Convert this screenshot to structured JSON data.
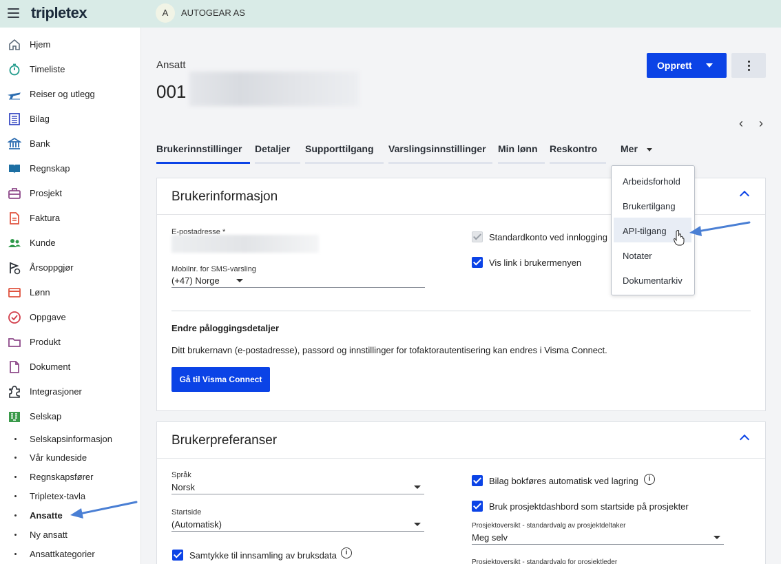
{
  "topbar": {
    "logo": "tripletex",
    "company_initial": "A",
    "company_name": "AUTOGEAR AS"
  },
  "sidebar": {
    "items": [
      {
        "label": "Hjem",
        "icon": "home-icon"
      },
      {
        "label": "Timeliste",
        "icon": "stopwatch-icon"
      },
      {
        "label": "Reiser og utlegg",
        "icon": "plane-icon"
      },
      {
        "label": "Bilag",
        "icon": "receipt-icon"
      },
      {
        "label": "Bank",
        "icon": "bank-icon"
      },
      {
        "label": "Regnskap",
        "icon": "book-icon"
      },
      {
        "label": "Prosjekt",
        "icon": "briefcase-icon"
      },
      {
        "label": "Faktura",
        "icon": "invoice-icon"
      },
      {
        "label": "Kunde",
        "icon": "people-icon"
      },
      {
        "label": "Årsoppgjør",
        "icon": "flag-icon"
      },
      {
        "label": "Lønn",
        "icon": "card-icon"
      },
      {
        "label": "Oppgave",
        "icon": "check-circle-icon"
      },
      {
        "label": "Produkt",
        "icon": "folder-icon"
      },
      {
        "label": "Dokument",
        "icon": "document-icon"
      },
      {
        "label": "Integrasjoner",
        "icon": "puzzle-icon"
      },
      {
        "label": "Selskap",
        "icon": "building-icon"
      }
    ],
    "subitems": [
      {
        "label": "Selskapsinformasjon"
      },
      {
        "label": "Vår kundeside"
      },
      {
        "label": "Regnskapsfører"
      },
      {
        "label": "Tripletex-tavla"
      },
      {
        "label": "Ansatte",
        "active": true
      },
      {
        "label": "Ny ansatt"
      },
      {
        "label": "Ansattkategorier"
      }
    ]
  },
  "page": {
    "breadcrumb": "Ansatt",
    "employee_number": "001",
    "create_button": "Opprett",
    "tabs": [
      "Brukerinnstillinger",
      "Detaljer",
      "Supporttilgang",
      "Varslingsinnstillinger",
      "Min lønn",
      "Reskontro",
      "Mer"
    ],
    "more_menu": [
      "Arbeidsforhold",
      "Brukertilgang",
      "API-tilgang",
      "Notater",
      "Dokumentarkiv"
    ]
  },
  "user_info": {
    "title": "Brukerinformasjon",
    "email_label": "E-postadresse *",
    "mobile_label": "Mobilnr. for SMS-varsling",
    "mobile_value": "(+47) Norge",
    "standard_account": "Standardkonto ved innlogging",
    "show_link": "Vis link i brukermenyen",
    "login_heading": "Endre påloggingsdetaljer",
    "login_text": "Ditt brukernavn (e-postadresse), passord og innstillinger for tofaktorautentisering kan endres i Visma Connect.",
    "visma_button": "Gå til Visma Connect"
  },
  "user_prefs": {
    "title": "Brukerpreferanser",
    "language_label": "Språk",
    "language_value": "Norsk",
    "startpage_label": "Startside",
    "startpage_value": "(Automatisk)",
    "consent": "Samtykke til innsamling av bruksdata",
    "auto_post": "Bilag bokføres automatisk ved lagring",
    "project_dashboard": "Bruk prosjektdashbord som startside på prosjekter",
    "participant_label": "Prosjektoversikt - standardvalg av prosjektdeltaker",
    "participant_value": "Meg selv",
    "leader_label": "Prosjektoversikt - standardvalg for prosjektleder"
  },
  "colors": {
    "accent": "#0b43e6",
    "topbar": "#d9ebe7",
    "annotation_arrow": "#4a7fd4"
  }
}
